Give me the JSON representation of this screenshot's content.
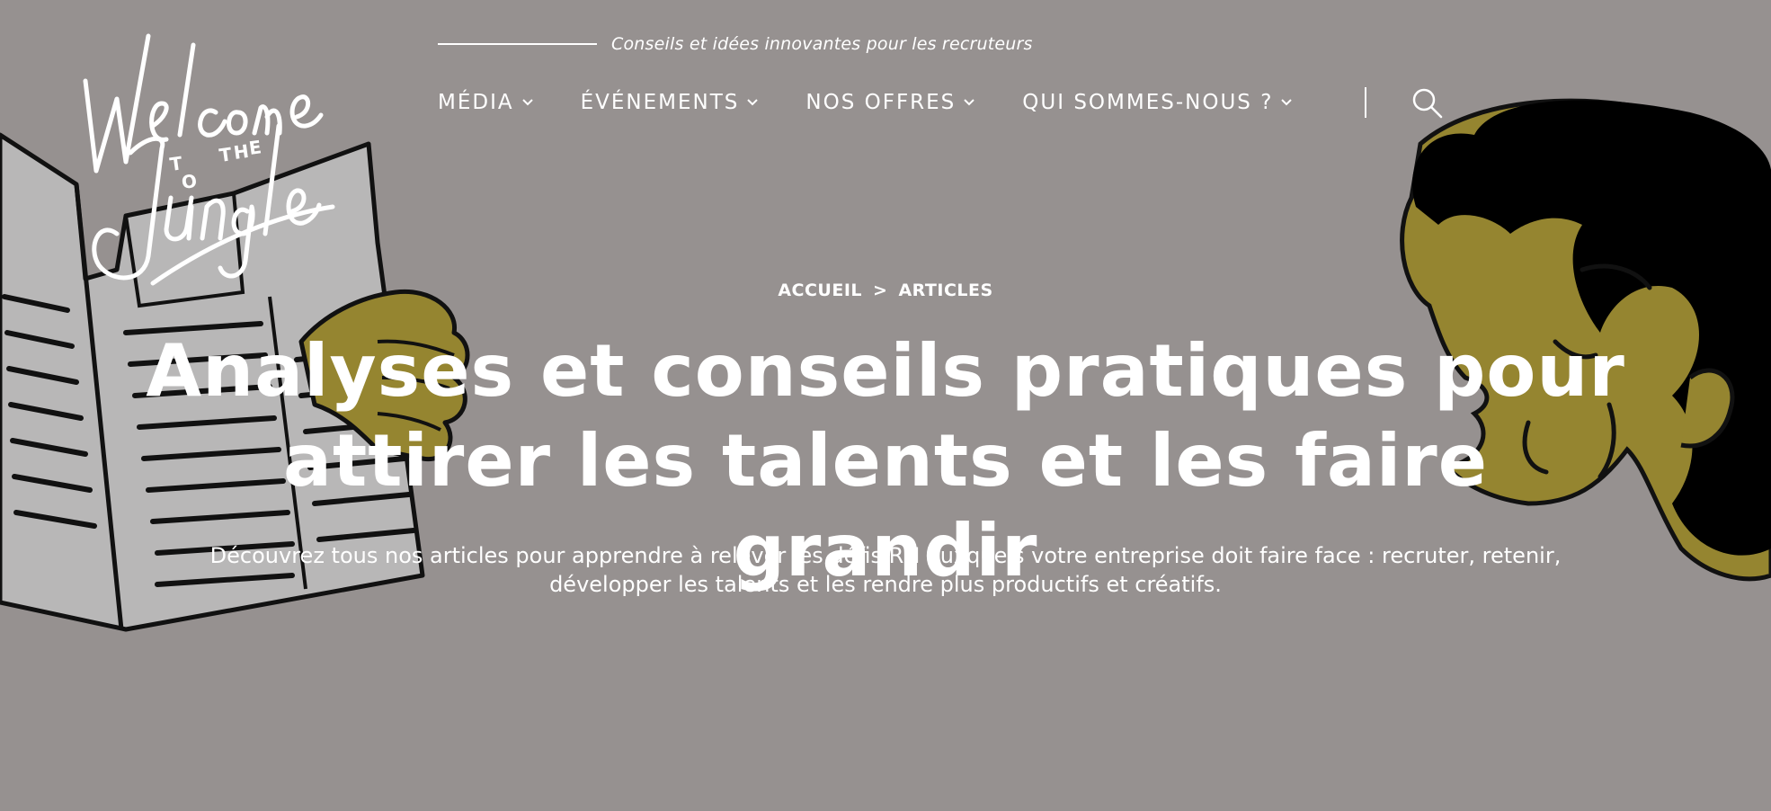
{
  "brand": {
    "logo_text": "Welcome to the Jungle",
    "tagline": "Conseils et idées innovantes pour les recruteurs"
  },
  "nav": {
    "items": [
      {
        "label": "MÉDIA"
      },
      {
        "label": "ÉVÉNEMENTS"
      },
      {
        "label": "NOS OFFRES"
      },
      {
        "label": "QUI SOMMES-NOUS ?"
      }
    ]
  },
  "icons": {
    "search": "search-icon",
    "chevron": "chevron-down-icon"
  },
  "breadcrumb": {
    "home": "ACCUEIL",
    "separator": ">",
    "current": "ARTICLES"
  },
  "hero": {
    "title_line1": "Analyses et conseils pratiques pour",
    "title_line2": "attirer les talents et les faire grandir",
    "subtitle_line1": "Découvrez tous nos articles pour apprendre à relever les défis RH auxquels votre entreprise doit faire face : recruter, retenir,",
    "subtitle_line2": "développer les talents et les rendre plus productifs et créatifs."
  },
  "colors": {
    "background": "#969190",
    "text": "#ffffff",
    "illustration_olive": "#958530",
    "illustration_paper": "#b8b7b7"
  }
}
